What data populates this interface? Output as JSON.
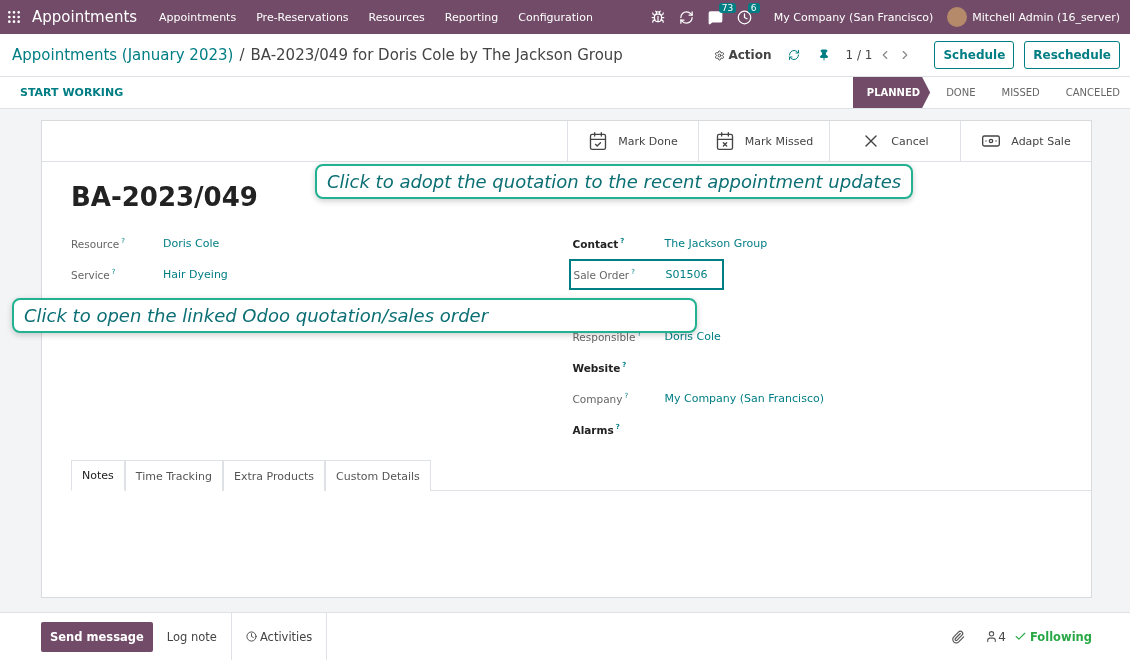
{
  "navbar": {
    "app_name": "Appointments",
    "menus": [
      "Appointments",
      "Pre-Reservations",
      "Resources",
      "Reporting",
      "Configuration"
    ],
    "chat_count": "73",
    "activity_count": "6",
    "company": "My Company (San Francisco)",
    "user": "Mitchell Admin (16_server)"
  },
  "breadcrumb": {
    "parent": "Appointments (January 2023)",
    "separator": "/",
    "current": "BA-2023/049 for Doris Cole by The Jackson Group"
  },
  "control": {
    "action": "Action",
    "pager": "1 / 1",
    "buttons": [
      "Schedule",
      "Reschedule"
    ]
  },
  "status_bar": {
    "button": "START WORKING",
    "stages": [
      {
        "label": "PLANNED",
        "selected": true
      },
      {
        "label": "DONE",
        "selected": false
      },
      {
        "label": "MISSED",
        "selected": false
      },
      {
        "label": "CANCELED",
        "selected": false
      }
    ]
  },
  "sheet_buttons": [
    "Mark Done",
    "Mark Missed",
    "Cancel",
    "Adapt Sale"
  ],
  "title": "BA-2023/049",
  "left_fields": [
    {
      "label": "Resource",
      "value": "Doris Cole",
      "required": false,
      "highlighted": false
    },
    {
      "label": "Service",
      "value": "Hair Dyeing",
      "required": false,
      "highlighted": false
    }
  ],
  "right_fields": [
    {
      "label": "Contact",
      "value": "The Jackson Group",
      "required": true,
      "highlighted": false
    },
    {
      "label": "Sale Order",
      "value": "S01506",
      "required": false,
      "highlighted": true
    },
    {
      "label": "Responsible",
      "value": "Doris Cole",
      "required": false,
      "highlighted": false
    },
    {
      "label": "Website",
      "required": true,
      "highlighted": false
    },
    {
      "label": "Company",
      "value": "My Company (San Francisco)",
      "required": false,
      "highlighted": false
    },
    {
      "label": "Alarms",
      "required": true,
      "highlighted": false
    }
  ],
  "help_mark": "?",
  "tabs": [
    {
      "label": "Notes",
      "selected": true
    },
    {
      "label": "Time Tracking",
      "selected": false
    },
    {
      "label": "Extra Products",
      "selected": false
    },
    {
      "label": "Custom Details",
      "selected": false
    }
  ],
  "callouts": [
    "Click to adopt the quotation to the recent appointment updates",
    "Click to open the linked Odoo quotation/sales order"
  ],
  "chatter": {
    "send": "Send message",
    "log": "Log note",
    "activities": "Activities",
    "followers": "4",
    "following": "Following"
  }
}
